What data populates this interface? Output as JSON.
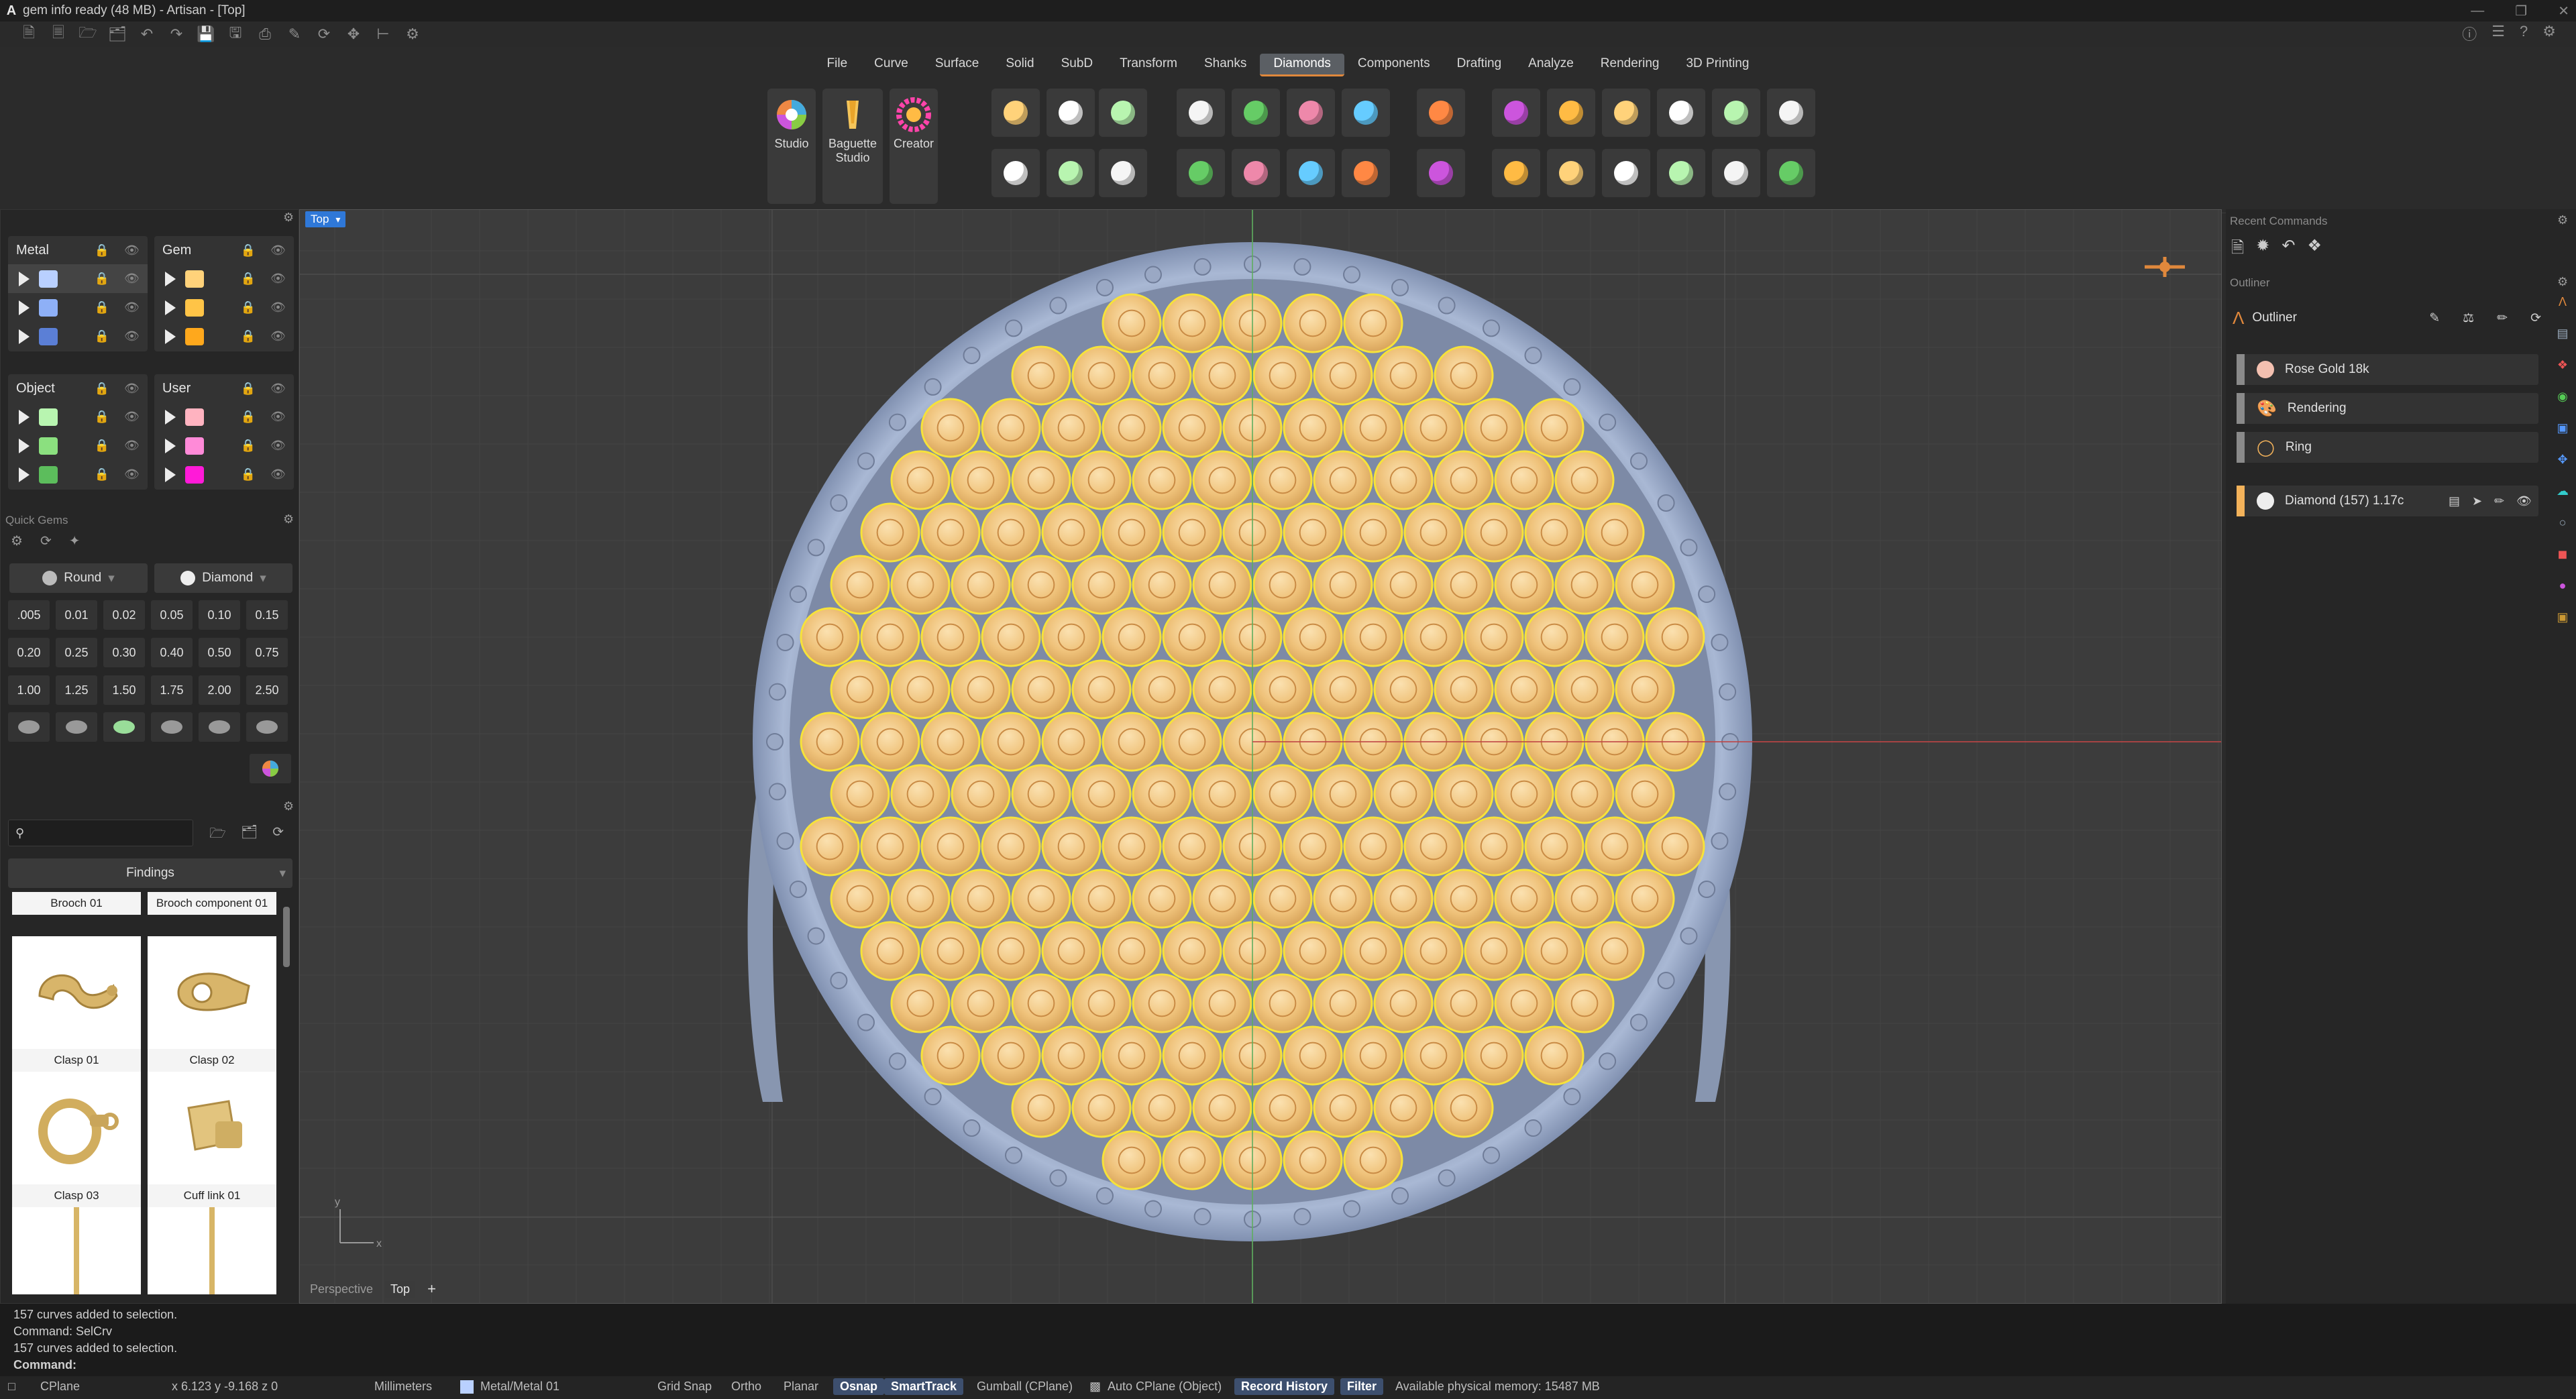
{
  "window": {
    "title": "gem info ready (48 MB) - Artisan - [Top]"
  },
  "menu": [
    "File",
    "Curve",
    "Surface",
    "Solid",
    "SubD",
    "Transform",
    "Shanks",
    "Diamonds",
    "Components",
    "Drafting",
    "Analyze",
    "Rendering",
    "3D Printing"
  ],
  "menu_active": "Diamonds",
  "ribbon": {
    "studio_label": "Studio",
    "baguette_label": "Baguette Studio",
    "creator_label": "Creator"
  },
  "layers": {
    "metal": {
      "title": "Metal",
      "colors": [
        "#b9d0ff",
        "#8eb0f7",
        "#5b7fd6"
      ]
    },
    "gem": {
      "title": "Gem",
      "colors": [
        "#ffd27a",
        "#ffc447",
        "#ffa81c"
      ]
    },
    "object": {
      "title": "Object",
      "colors": [
        "#b8f5b0",
        "#8be07f",
        "#5cbd5c"
      ]
    },
    "user": {
      "title": "User",
      "colors": [
        "#ffb3c0",
        "#ff8ad8",
        "#ff1ad8"
      ]
    }
  },
  "quick_gems": {
    "title": "Quick Gems",
    "shape": "Round",
    "material": "Diamond",
    "sizes": [
      ".005",
      "0.01",
      "0.02",
      "0.05",
      "0.10",
      "0.15",
      "0.20",
      "0.25",
      "0.30",
      "0.40",
      "0.50",
      "0.75",
      "1.00",
      "1.25",
      "1.50",
      "1.75",
      "2.00",
      "2.50"
    ]
  },
  "library": {
    "search_placeholder": "",
    "category": "Findings",
    "items": [
      "Brooch 01",
      "Brooch component 01",
      "Clasp 01",
      "Clasp 02",
      "Clasp 03",
      "Cuff link 01"
    ]
  },
  "viewport": {
    "label": "Top",
    "tabs": [
      "Perspective",
      "Top"
    ]
  },
  "right_panel": {
    "recent_title": "Recent Commands",
    "outliner_title": "Outliner",
    "outliner_header": "Outliner",
    "items": [
      "Rose Gold 18k",
      "Rendering",
      "Ring"
    ],
    "diamond_item": "Diamond (157) 1.17c"
  },
  "command": {
    "history": [
      "157 curves added to selection.",
      "Command: SelCrv",
      "157 curves added to selection."
    ],
    "prompt": "Command:"
  },
  "status": {
    "cplane": "CPlane",
    "coords": "x 6.123   y -9.168   z 0",
    "units": "Millimeters",
    "layer": "Metal/Metal 01",
    "grid_snap": "Grid Snap",
    "ortho": "Ortho",
    "planar": "Planar",
    "osnap": "Osnap",
    "smarttrack": "SmartTrack",
    "gumball": "Gumball (CPlane)",
    "auto_cplane": "Auto CPlane (Object)",
    "record_history": "Record History",
    "filter": "Filter",
    "memory": "Available physical memory: 15487 MB"
  },
  "colors": {
    "accent_orange": "#e0883c",
    "viewport_bg": "#3c3c3c",
    "ring_blue": "#9fb1d0",
    "gem_gold": "#f3c47b",
    "prong_yellow": "#f6e23a"
  }
}
